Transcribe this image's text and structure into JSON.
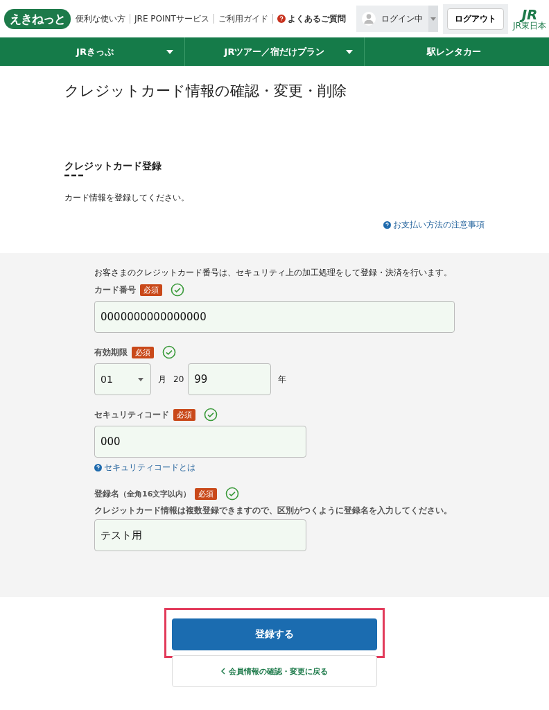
{
  "header": {
    "logo": "えきねっと",
    "links": [
      {
        "label": "便利な使い方",
        "help": false
      },
      {
        "label": "JRE POINTサービス",
        "help": false
      },
      {
        "label": "ご利用ガイド",
        "help": false
      },
      {
        "label": "よくあるご質問",
        "help": true
      }
    ],
    "account": "ログイン中",
    "logout": "ログアウト",
    "brand": "JR",
    "brand_sub": "JR東日本"
  },
  "nav": [
    {
      "label": "JRきっぷ",
      "dropdown": true
    },
    {
      "label": "JRツアー／宿だけプラン",
      "dropdown": true
    },
    {
      "label": "駅レンタカー",
      "dropdown": false
    }
  ],
  "page_title": "クレジットカード情報の確認・変更・削除",
  "section": {
    "heading": "クレジットカード登録",
    "intro": "カード情報を登録してください。",
    "help_link": "お支払い方法の注意事項"
  },
  "form": {
    "notice": "お客さまのクレジットカード番号は、セキュリティ上の加工処理をして登録・決済を行います。",
    "fields": [
      {
        "kind": "long_text",
        "label": "カード番号",
        "required": "必須",
        "valid": true,
        "value": "0000000000000000"
      },
      {
        "kind": "expiry",
        "label": "有効期限",
        "required": "必須",
        "valid": true,
        "month": "01",
        "month_unit": "月",
        "year_prefix": "20",
        "year": "99",
        "year_unit": "年"
      },
      {
        "kind": "text",
        "label": "セキュリティコード",
        "required": "必須",
        "valid": true,
        "value": "000",
        "help_link": "セキュリティコードとは"
      },
      {
        "kind": "text",
        "label": "登録名",
        "label_note": "（全角16文字以内）",
        "required": "必須",
        "valid": true,
        "hint": "クレジットカード情報は複数登録できますので、区別がつくように登録名を入力してください。",
        "value": "テスト用"
      }
    ]
  },
  "submit": {
    "label": "登録する",
    "highlighted": true
  },
  "back_link": "会員情報の確認・変更に戻る"
}
